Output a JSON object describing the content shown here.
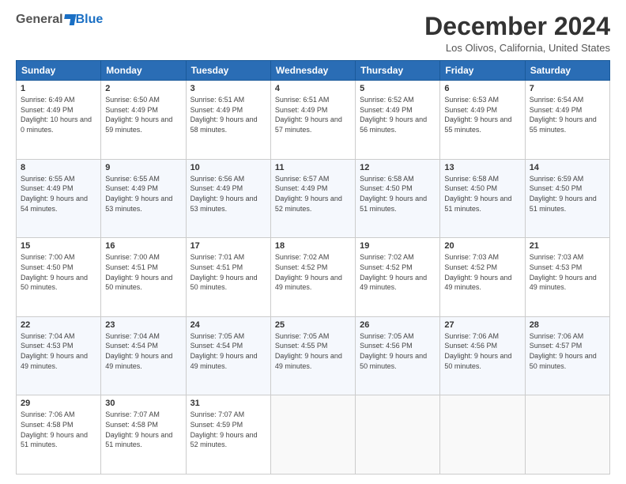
{
  "logo": {
    "general": "General",
    "blue": "Blue"
  },
  "header": {
    "title": "December 2024",
    "location": "Los Olivos, California, United States"
  },
  "days_of_week": [
    "Sunday",
    "Monday",
    "Tuesday",
    "Wednesday",
    "Thursday",
    "Friday",
    "Saturday"
  ],
  "weeks": [
    [
      {
        "day": "1",
        "sunrise": "6:49 AM",
        "sunset": "4:49 PM",
        "daylight": "10 hours and 0 minutes."
      },
      {
        "day": "2",
        "sunrise": "6:50 AM",
        "sunset": "4:49 PM",
        "daylight": "9 hours and 59 minutes."
      },
      {
        "day": "3",
        "sunrise": "6:51 AM",
        "sunset": "4:49 PM",
        "daylight": "9 hours and 58 minutes."
      },
      {
        "day": "4",
        "sunrise": "6:51 AM",
        "sunset": "4:49 PM",
        "daylight": "9 hours and 57 minutes."
      },
      {
        "day": "5",
        "sunrise": "6:52 AM",
        "sunset": "4:49 PM",
        "daylight": "9 hours and 56 minutes."
      },
      {
        "day": "6",
        "sunrise": "6:53 AM",
        "sunset": "4:49 PM",
        "daylight": "9 hours and 55 minutes."
      },
      {
        "day": "7",
        "sunrise": "6:54 AM",
        "sunset": "4:49 PM",
        "daylight": "9 hours and 55 minutes."
      }
    ],
    [
      {
        "day": "8",
        "sunrise": "6:55 AM",
        "sunset": "4:49 PM",
        "daylight": "9 hours and 54 minutes."
      },
      {
        "day": "9",
        "sunrise": "6:55 AM",
        "sunset": "4:49 PM",
        "daylight": "9 hours and 53 minutes."
      },
      {
        "day": "10",
        "sunrise": "6:56 AM",
        "sunset": "4:49 PM",
        "daylight": "9 hours and 53 minutes."
      },
      {
        "day": "11",
        "sunrise": "6:57 AM",
        "sunset": "4:49 PM",
        "daylight": "9 hours and 52 minutes."
      },
      {
        "day": "12",
        "sunrise": "6:58 AM",
        "sunset": "4:50 PM",
        "daylight": "9 hours and 51 minutes."
      },
      {
        "day": "13",
        "sunrise": "6:58 AM",
        "sunset": "4:50 PM",
        "daylight": "9 hours and 51 minutes."
      },
      {
        "day": "14",
        "sunrise": "6:59 AM",
        "sunset": "4:50 PM",
        "daylight": "9 hours and 51 minutes."
      }
    ],
    [
      {
        "day": "15",
        "sunrise": "7:00 AM",
        "sunset": "4:50 PM",
        "daylight": "9 hours and 50 minutes."
      },
      {
        "day": "16",
        "sunrise": "7:00 AM",
        "sunset": "4:51 PM",
        "daylight": "9 hours and 50 minutes."
      },
      {
        "day": "17",
        "sunrise": "7:01 AM",
        "sunset": "4:51 PM",
        "daylight": "9 hours and 50 minutes."
      },
      {
        "day": "18",
        "sunrise": "7:02 AM",
        "sunset": "4:52 PM",
        "daylight": "9 hours and 49 minutes."
      },
      {
        "day": "19",
        "sunrise": "7:02 AM",
        "sunset": "4:52 PM",
        "daylight": "9 hours and 49 minutes."
      },
      {
        "day": "20",
        "sunrise": "7:03 AM",
        "sunset": "4:52 PM",
        "daylight": "9 hours and 49 minutes."
      },
      {
        "day": "21",
        "sunrise": "7:03 AM",
        "sunset": "4:53 PM",
        "daylight": "9 hours and 49 minutes."
      }
    ],
    [
      {
        "day": "22",
        "sunrise": "7:04 AM",
        "sunset": "4:53 PM",
        "daylight": "9 hours and 49 minutes."
      },
      {
        "day": "23",
        "sunrise": "7:04 AM",
        "sunset": "4:54 PM",
        "daylight": "9 hours and 49 minutes."
      },
      {
        "day": "24",
        "sunrise": "7:05 AM",
        "sunset": "4:54 PM",
        "daylight": "9 hours and 49 minutes."
      },
      {
        "day": "25",
        "sunrise": "7:05 AM",
        "sunset": "4:55 PM",
        "daylight": "9 hours and 49 minutes."
      },
      {
        "day": "26",
        "sunrise": "7:05 AM",
        "sunset": "4:56 PM",
        "daylight": "9 hours and 50 minutes."
      },
      {
        "day": "27",
        "sunrise": "7:06 AM",
        "sunset": "4:56 PM",
        "daylight": "9 hours and 50 minutes."
      },
      {
        "day": "28",
        "sunrise": "7:06 AM",
        "sunset": "4:57 PM",
        "daylight": "9 hours and 50 minutes."
      }
    ],
    [
      {
        "day": "29",
        "sunrise": "7:06 AM",
        "sunset": "4:58 PM",
        "daylight": "9 hours and 51 minutes."
      },
      {
        "day": "30",
        "sunrise": "7:07 AM",
        "sunset": "4:58 PM",
        "daylight": "9 hours and 51 minutes."
      },
      {
        "day": "31",
        "sunrise": "7:07 AM",
        "sunset": "4:59 PM",
        "daylight": "9 hours and 52 minutes."
      },
      null,
      null,
      null,
      null
    ]
  ]
}
